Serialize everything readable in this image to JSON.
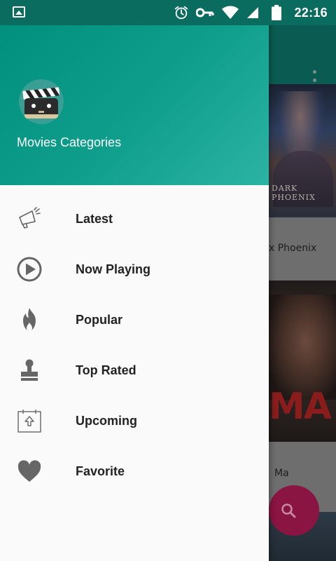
{
  "status_bar": {
    "time": "22:16",
    "icons": [
      "image-icon",
      "alarm-icon",
      "key-icon",
      "wifi-icon",
      "cell-signal-icon",
      "battery-icon"
    ]
  },
  "background_app": {
    "movie_titles": [
      "x Phoenix",
      "Ma"
    ],
    "poster_text": [
      "DARK",
      "PHOENIX"
    ],
    "poster_mark": "MA",
    "fab_icon": "search-icon"
  },
  "drawer": {
    "header_title": "Movies Categories",
    "avatar_icon": "clapperboard-icon",
    "items": [
      {
        "label": "Latest",
        "icon": "megaphone-icon"
      },
      {
        "label": "Now Playing",
        "icon": "play-circle-icon"
      },
      {
        "label": "Popular",
        "icon": "flame-icon"
      },
      {
        "label": "Top Rated",
        "icon": "stamp-icon"
      },
      {
        "label": "Upcoming",
        "icon": "calendar-upload-icon"
      },
      {
        "label": "Favorite",
        "icon": "heart-icon"
      }
    ]
  },
  "colors": {
    "header_start": "#008e7c",
    "header_end": "#2bb3a3",
    "status_bar": "#0a6b5f",
    "icon_gray": "#666666",
    "fab_accent": "#8a1442"
  }
}
